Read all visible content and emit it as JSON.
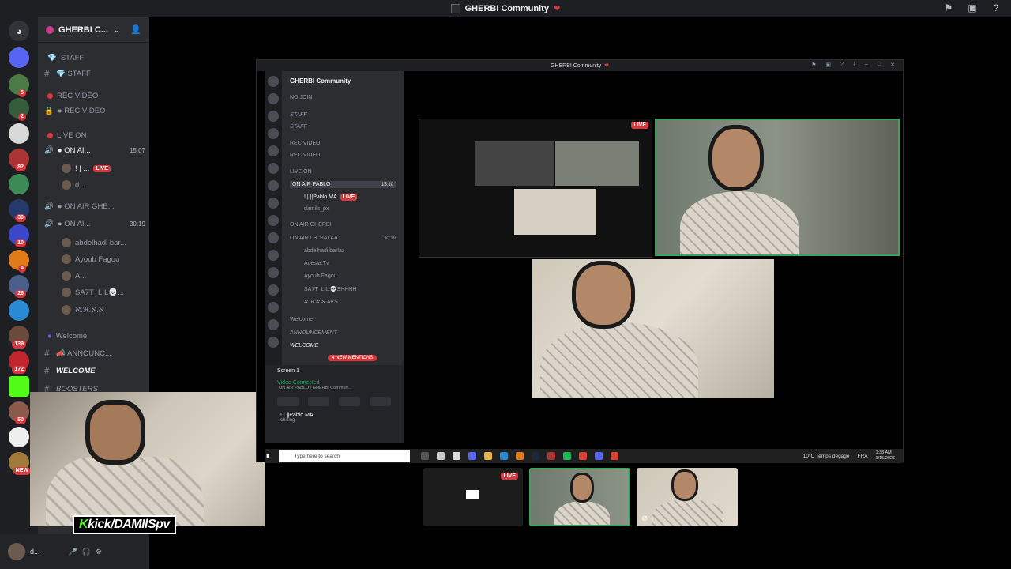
{
  "titlebar": {
    "title": "GHERBI Community",
    "heart": "❤"
  },
  "sidebar": {
    "server_name": "GHERBI C...",
    "badges": [
      "5",
      "2",
      "82",
      "39",
      "10",
      "4",
      "26",
      "139",
      "172",
      "50",
      "NEW"
    ],
    "rows": [
      {
        "icon": "💎",
        "label": "STAFF",
        "type": "category"
      },
      {
        "icon": "#",
        "label": "💎 STAFF",
        "type": "text"
      },
      {
        "icon": "●",
        "label": "REC VIDEO",
        "type": "category"
      },
      {
        "icon": "🔒",
        "label": "● REC VIDEO",
        "type": "voice"
      },
      {
        "icon": "●",
        "label": "LIVE ON",
        "type": "category"
      },
      {
        "icon": "🔊",
        "label": "● ON AI...",
        "type": "voice-active",
        "time": "15:07"
      },
      {
        "icon": "",
        "label": "! | ...",
        "type": "user",
        "live": "LIVE"
      },
      {
        "icon": "",
        "label": "d...",
        "type": "user"
      },
      {
        "icon": "🔊",
        "label": "● ON AIR GHE...",
        "type": "voice"
      },
      {
        "icon": "🔊",
        "label": "● ON AI...",
        "type": "voice",
        "time": "30:19"
      },
      {
        "icon": "",
        "label": "abdelhadi bar...",
        "type": "user"
      },
      {
        "icon": "",
        "label": "Ayoub Fagou",
        "type": "user"
      },
      {
        "icon": "",
        "label": "A...",
        "type": "user"
      },
      {
        "icon": "",
        "label": "SA7T_LIL💀...",
        "type": "user"
      },
      {
        "icon": "",
        "label": "ℵ.ℜ.ℵ.ℵ",
        "type": "user"
      },
      {
        "icon": "●",
        "label": "Welcome",
        "type": "category"
      },
      {
        "icon": "#",
        "label": "📣 ANNOUNC...",
        "type": "text"
      },
      {
        "icon": "#",
        "label": "WELCOME",
        "type": "text"
      },
      {
        "icon": "#",
        "label": "BOOSTERS",
        "type": "text"
      }
    ],
    "user": {
      "name": "d..."
    }
  },
  "overlay": {
    "tag_k": "K",
    "tag_text": "kick/DAMIlSpv"
  },
  "inner": {
    "title": "GHERBI Community",
    "server": "GHERBI Community",
    "rows": [
      "NO JOIN",
      "STAFF",
      "STAFF",
      "REC VIDEO",
      "REC VIDEO",
      "LIVE ON",
      "ON AIR PABLO",
      "! | ||Pablo MA",
      "damils_px",
      "ON AIR GHERBI",
      "ON AIR LBLBALAA",
      "abdelhadi barlaz",
      "Adesta.Tv",
      "Ayoub Fagou",
      "SA7T_LIL 💀SHHHH",
      "ℵ.ℜ.ℵ.ℵ AKS",
      "Welcome",
      "ANNOUNCEMENT",
      "WELCOME",
      "4 NEW MENTIONS"
    ],
    "active_time": "15:10",
    "time2": "30:19",
    "screen": "Screen 1",
    "video_connected": "Video Connected",
    "vc_sub": "ON AIR PABLO / GHERBI Commun...",
    "user": "! | ||Pablo MA",
    "user_status": "chilling",
    "live": "LIVE"
  },
  "taskbar": {
    "search_placeholder": "Type here to search",
    "weather": "10°C  Temps dégagé",
    "lang": "FRA",
    "time": "1:38 AM",
    "date": "1/15/2026"
  },
  "thumbs": {
    "live": "LIVE"
  }
}
